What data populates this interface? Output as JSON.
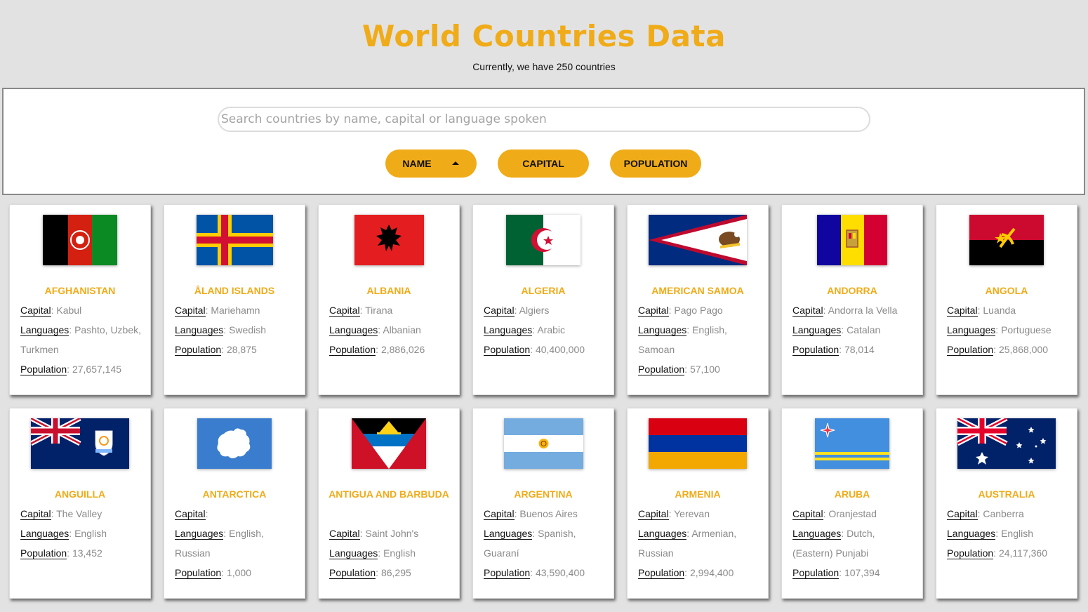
{
  "header": {
    "title": "World Countries Data",
    "subtitle": "Currently, we have 250 countries"
  },
  "search": {
    "placeholder": "Search countries by name, capital or language spoken",
    "value": ""
  },
  "sort_buttons": [
    {
      "label": "NAME",
      "active": true,
      "direction": "ascending"
    },
    {
      "label": "CAPITAL",
      "active": false
    },
    {
      "label": "POPULATION",
      "active": false
    }
  ],
  "labels": {
    "capital": "Capital",
    "languages": "Languages",
    "population": "Population"
  },
  "colors": {
    "accent": "#f0ab18",
    "page_bg": "#e2e2e2",
    "muted_text": "#8a8a8a"
  },
  "countries": [
    {
      "name": "AFGHANISTAN",
      "capital": "Kabul",
      "languages": "Pashto, Uzbek, Turkmen",
      "population": "27,657,145",
      "flag": "afghanistan-flag"
    },
    {
      "name": "ÅLAND ISLANDS",
      "capital": "Mariehamn",
      "languages": "Swedish",
      "population": "28,875",
      "flag": "aland-flag"
    },
    {
      "name": "ALBANIA",
      "capital": "Tirana",
      "languages": "Albanian",
      "population": "2,886,026",
      "flag": "albania-flag"
    },
    {
      "name": "ALGERIA",
      "capital": "Algiers",
      "languages": "Arabic",
      "population": "40,400,000",
      "flag": "algeria-flag"
    },
    {
      "name": "AMERICAN SAMOA",
      "capital": "Pago Pago",
      "languages": "English, Samoan",
      "population": "57,100",
      "flag": "american-samoa-flag"
    },
    {
      "name": "ANDORRA",
      "capital": "Andorra la Vella",
      "languages": "Catalan",
      "population": "78,014",
      "flag": "andorra-flag"
    },
    {
      "name": "ANGOLA",
      "capital": "Luanda",
      "languages": "Portuguese",
      "population": "25,868,000",
      "flag": "angola-flag"
    },
    {
      "name": "ANGUILLA",
      "capital": "The Valley",
      "languages": "English",
      "population": "13,452",
      "flag": "anguilla-flag"
    },
    {
      "name": "ANTARCTICA",
      "capital": "",
      "languages": "English, Russian",
      "population": "1,000",
      "flag": "antarctica-flag"
    },
    {
      "name": "ANTIGUA AND BARBUDA",
      "capital": "Saint John's",
      "languages": "English",
      "population": "86,295",
      "flag": "antigua-flag"
    },
    {
      "name": "ARGENTINA",
      "capital": "Buenos Aires",
      "languages": "Spanish, Guaraní",
      "population": "43,590,400",
      "flag": "argentina-flag"
    },
    {
      "name": "ARMENIA",
      "capital": "Yerevan",
      "languages": "Armenian, Russian",
      "population": "2,994,400",
      "flag": "armenia-flag"
    },
    {
      "name": "ARUBA",
      "capital": "Oranjestad",
      "languages": "Dutch, (Eastern) Punjabi",
      "population": "107,394",
      "flag": "aruba-flag"
    },
    {
      "name": "AUSTRALIA",
      "capital": "Canberra",
      "languages": "English",
      "population": "24,117,360",
      "flag": "australia-flag"
    }
  ]
}
